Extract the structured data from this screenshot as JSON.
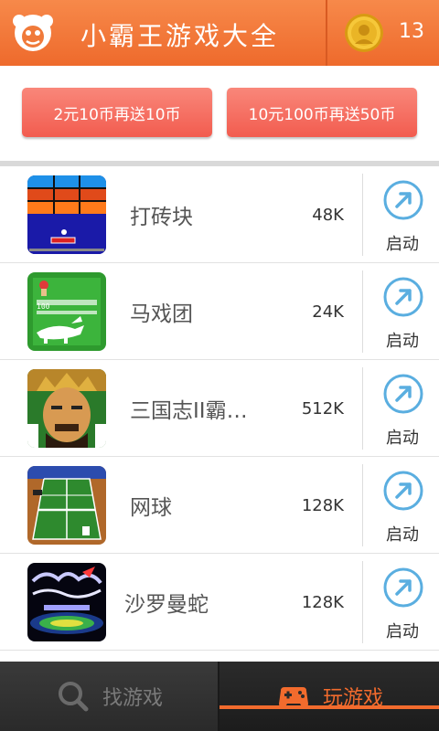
{
  "header": {
    "title": "小霸王游戏大全",
    "coin_count": "13",
    "logo_icon": "face-logo-icon",
    "coin_icon": "gold-coin-icon"
  },
  "promo": {
    "button1": "2元10币再送10币",
    "button2": "10元100币再送50币"
  },
  "games": [
    {
      "name": "打砖块",
      "size": "48K",
      "launch": "启动",
      "icon": "brick-breaker-thumbnail"
    },
    {
      "name": "马戏团",
      "size": "24K",
      "launch": "启动",
      "icon": "circus-thumbnail"
    },
    {
      "name": "三国志II霸…",
      "size": "512K",
      "launch": "启动",
      "icon": "three-kingdoms-thumbnail"
    },
    {
      "name": "网球",
      "size": "128K",
      "launch": "启动",
      "icon": "tennis-thumbnail"
    },
    {
      "name": "沙罗曼蛇",
      "size": "128K",
      "launch": "启动",
      "icon": "salamander-thumbnail"
    }
  ],
  "nav": {
    "find_label": "找游戏",
    "play_label": "玩游戏",
    "active_tab": "玩游戏"
  },
  "colors": {
    "brand_orange": "#f26b2d",
    "promo_red": "#f25c4f",
    "launch_blue": "#5aaee0"
  }
}
